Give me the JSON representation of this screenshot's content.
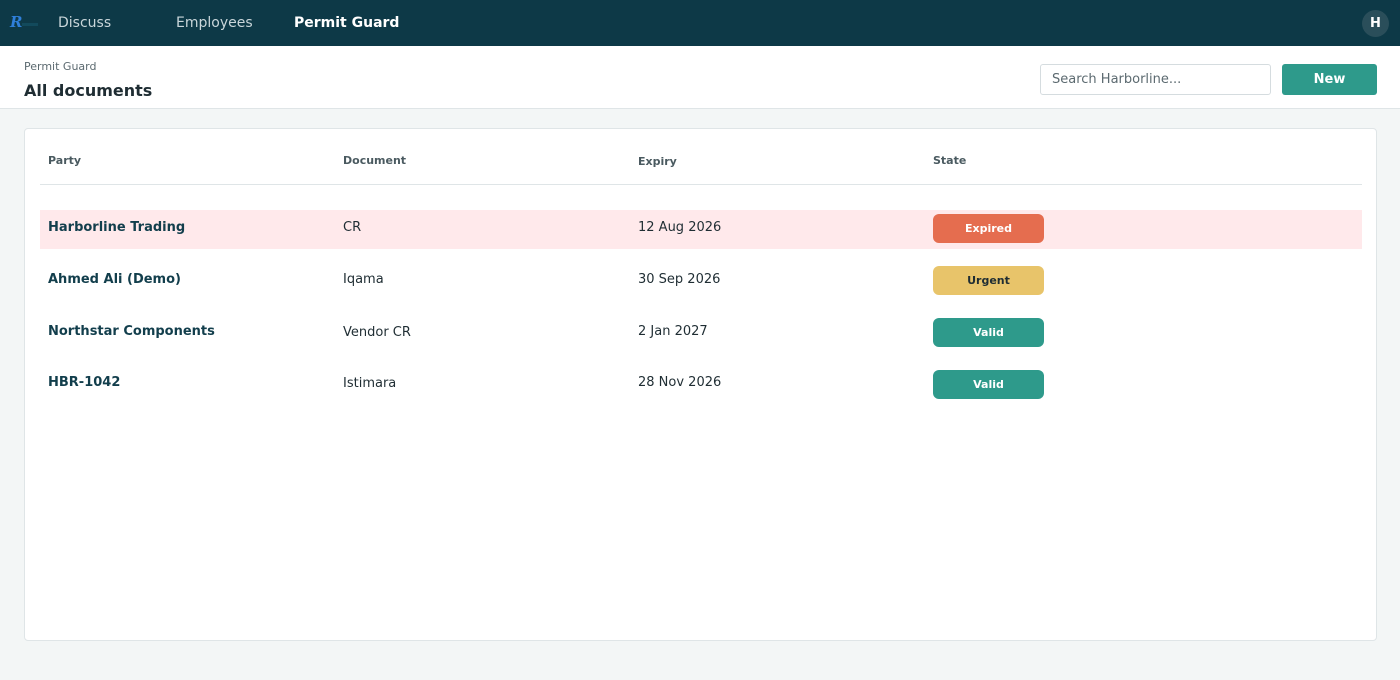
{
  "nav": {
    "items": [
      {
        "label": "Discuss",
        "active": false
      },
      {
        "label": "Employees",
        "active": false
      },
      {
        "label": "Permit Guard",
        "active": true
      }
    ],
    "avatar": "H"
  },
  "header": {
    "breadcrumb": "Permit Guard",
    "title": "All documents",
    "search_placeholder": "Search Harborline...",
    "new_label": "New"
  },
  "table": {
    "columns": [
      "Party",
      "Document",
      "Expiry",
      "State"
    ],
    "rows": [
      {
        "party": "Harborline Trading",
        "document": "CR",
        "expiry": "12 Aug 2026",
        "state": "Expired"
      },
      {
        "party": "Ahmed Ali (Demo)",
        "document": "Iqama",
        "expiry": "30 Sep 2026",
        "state": "Urgent"
      },
      {
        "party": "Northstar Components",
        "document": "Vendor CR",
        "expiry": "2 Jan 2027",
        "state": "Valid"
      },
      {
        "party": "HBR-1042",
        "document": "Istimara",
        "expiry": "28 Nov 2026",
        "state": "Valid"
      }
    ]
  },
  "colors": {
    "topbar": "#0d3947",
    "accent": "#2e9a8b",
    "expired": "#e56d4f",
    "urgent": "#e8c46a",
    "valid": "#2e9a8b",
    "expired_row": "#ffe9eb"
  }
}
